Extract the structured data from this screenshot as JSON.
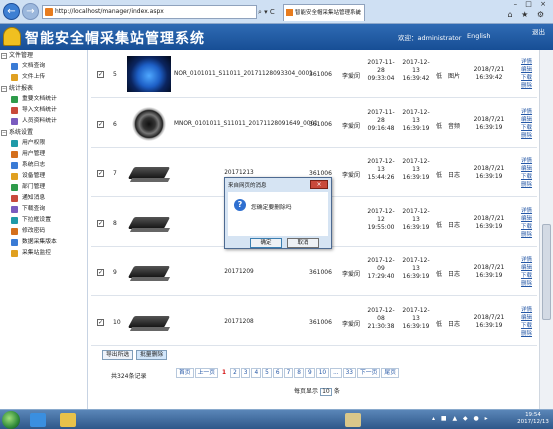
{
  "browser": {
    "url": "http://localhost/manager/index.aspx",
    "addr_tools": "⌕ ▾ C",
    "tab_title": "智能安全帽采集站管理系统",
    "tab_close": "×",
    "back_icon": "←",
    "forward_icon": "→",
    "window_controls": "– □ ×",
    "toolbar_icons": "⌂ ★ ⚙"
  },
  "header": {
    "title": "智能安全帽采集站管理系统",
    "welcome": "欢迎：administrator",
    "language": "English",
    "exit": "退出"
  },
  "sidebar": {
    "groups": [
      {
        "title": "文件管理",
        "items": [
          "文档查询",
          "文件上传"
        ]
      },
      {
        "title": "统计报表",
        "items": [
          "重要文档统计",
          "导入文档统计",
          "人员资料统计"
        ]
      },
      {
        "title": "系统设置",
        "items": [
          "用户权限",
          "用户管理",
          "系统日志",
          "设备管理",
          "部门管理",
          "通知消息",
          "下载查询",
          "下拉框设置",
          "修改密码",
          "数据采集版本",
          "采集站监控"
        ]
      }
    ],
    "group_toggle": "−"
  },
  "records": [
    {
      "index": "5",
      "file": "NOR_0101011_S11011_20171128093304_0001",
      "device": "361006",
      "user": "李爱闵",
      "time1": [
        "2017-11-",
        "28",
        "09:33:04"
      ],
      "time2": [
        "2017-12-",
        "13",
        "16:39:42"
      ],
      "level": "低",
      "type": "图片",
      "updated": [
        "2018/7/21",
        "16:39:42"
      ],
      "actions": [
        "详情",
        "编辑",
        "下载",
        "删除"
      ],
      "thumb": "planet"
    },
    {
      "index": "6",
      "file": "MNOR_0101011_S11011_20171128091649_0001",
      "device": "361006",
      "user": "李爱闵",
      "time1": [
        "2017-11-",
        "28",
        "09:16:48"
      ],
      "time2": [
        "2017-12-",
        "13",
        "16:39:19"
      ],
      "level": "低",
      "type": "音频",
      "updated": [
        "2018/7/21",
        "16:39:19"
      ],
      "actions": [
        "详情",
        "编辑",
        "下载",
        "删除"
      ],
      "thumb": "speaker"
    },
    {
      "index": "7",
      "file": "20171213",
      "device": "361006",
      "user": "李爱闵",
      "time1": [
        "2017-12-",
        "13",
        "15:44:26"
      ],
      "time2": [
        "2017-12-",
        "13",
        "16:39:19"
      ],
      "level": "低",
      "type": "日志",
      "updated": [
        "2018/7/21",
        "16:39:19"
      ],
      "actions": [
        "详情",
        "编辑",
        "下载",
        "删除"
      ],
      "thumb": "laptop"
    },
    {
      "index": "8",
      "file": "",
      "device": "",
      "user": "",
      "time1": [
        "2017-12-",
        "12",
        "19:55:00"
      ],
      "time2": [
        "2017-12-",
        "13",
        "16:39:19"
      ],
      "level": "低",
      "type": "日志",
      "updated": [
        "2018/7/21",
        "16:39:19"
      ],
      "actions": [
        "详情",
        "编辑",
        "下载",
        "删除"
      ],
      "thumb": "laptop"
    },
    {
      "index": "9",
      "file": "20171209",
      "device": "361006",
      "user": "李爱闵",
      "time1": [
        "2017-12-",
        "09",
        "17:29:40"
      ],
      "time2": [
        "2017-12-",
        "13",
        "16:39:19"
      ],
      "level": "低",
      "type": "日志",
      "updated": [
        "2018/7/21",
        "16:39:19"
      ],
      "actions": [
        "详情",
        "编辑",
        "下载",
        "删除"
      ],
      "thumb": "laptop"
    },
    {
      "index": "10",
      "file": "20171208",
      "device": "361006",
      "user": "李爱闵",
      "time1": [
        "2017-12-",
        "08",
        "21:30:38"
      ],
      "time2": [
        "2017-12-",
        "13",
        "16:39:19"
      ],
      "level": "低",
      "type": "日志",
      "updated": [
        "2018/7/21",
        "16:39:19"
      ],
      "actions": [
        "详情",
        "编辑",
        "下载",
        "删除"
      ],
      "thumb": "laptop"
    }
  ],
  "checkbox_mark": "✓",
  "list_footer": {
    "export_label": "导出所选",
    "bulk_delete_label": "批量删除",
    "total_records": "共324条记录",
    "pager": [
      "首页",
      "上一页",
      "1",
      "2",
      "3",
      "4",
      "5",
      "6",
      "7",
      "8",
      "9",
      "10",
      "...",
      "33",
      "下一页",
      "尾页"
    ],
    "current_page": "1",
    "page_size_prefix": "每页显示",
    "page_size_value": "10",
    "page_size_suffix": "条"
  },
  "dialog": {
    "title": "来自网页的消息",
    "close_label": "×",
    "icon": "?",
    "message": "您确定要删除吗",
    "ok_label": "确定",
    "cancel_label": "取消"
  },
  "taskbar": {
    "tray_icons": "▴ ■ ▲ ◆ ● ▸",
    "time": "19:54",
    "date": "2017/12/13"
  }
}
